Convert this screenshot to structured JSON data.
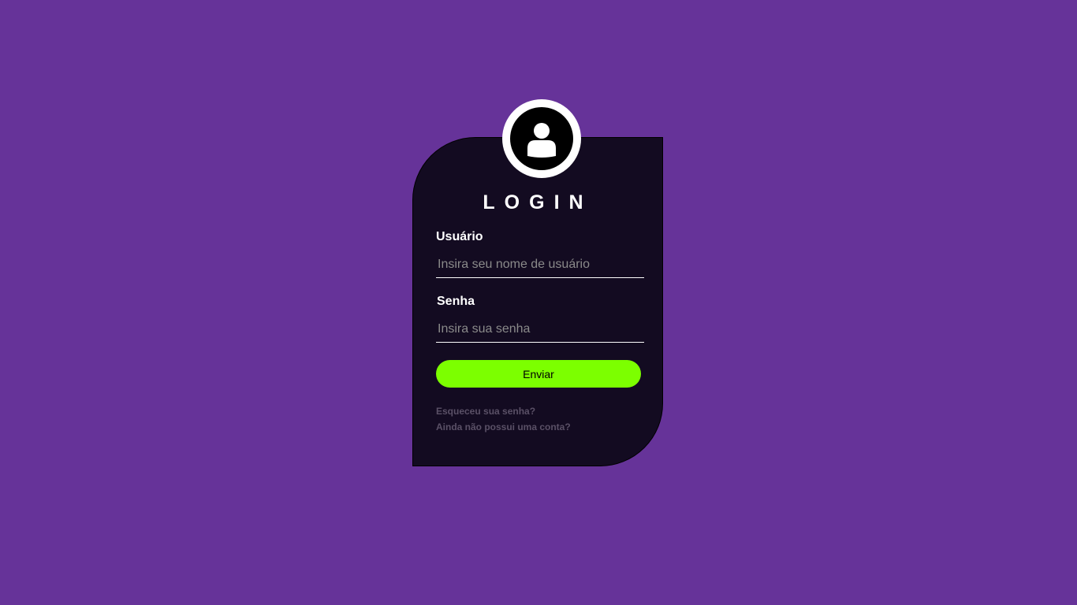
{
  "login": {
    "title": "LOGIN",
    "avatar_icon": "user-icon",
    "username": {
      "label": "Usuário",
      "placeholder": "Insira seu nome de usuário",
      "value": ""
    },
    "password": {
      "label": "Senha",
      "placeholder": "Insira sua senha",
      "value": ""
    },
    "submit_label": "Enviar",
    "forgot_password_link": "Esqueceu sua senha?",
    "signup_link": "Ainda não possui uma conta?"
  },
  "colors": {
    "page_background": "#663399",
    "card_background": "#130b21",
    "accent_button": "#7cff00",
    "link_text": "#5a5066"
  }
}
